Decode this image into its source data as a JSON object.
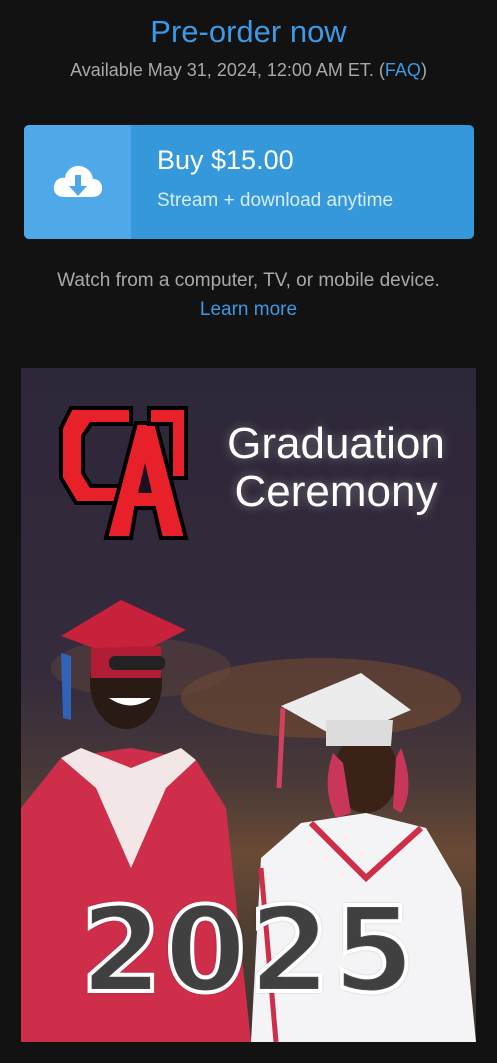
{
  "header": {
    "title": "Pre-order now",
    "availability_prefix": "Available May 31, 2024, 12:00 AM ET. (",
    "faq_label": "FAQ",
    "availability_suffix": ")"
  },
  "buy": {
    "label": "Buy $15.00",
    "sublabel": "Stream + download anytime",
    "icon": "cloud-download-icon"
  },
  "devices": {
    "text": "Watch from a computer, TV, or mobile device.",
    "learn_more": "Learn more"
  },
  "poster": {
    "logo_text": "CA",
    "title_line1": "Graduation",
    "title_line2": "Ceremony",
    "year": "2025"
  },
  "colors": {
    "background": "#121212",
    "accent": "#3a9ae6",
    "button": "#3498db",
    "button_icon_box": "#4fa9e8",
    "logo_red": "#e8202a"
  }
}
